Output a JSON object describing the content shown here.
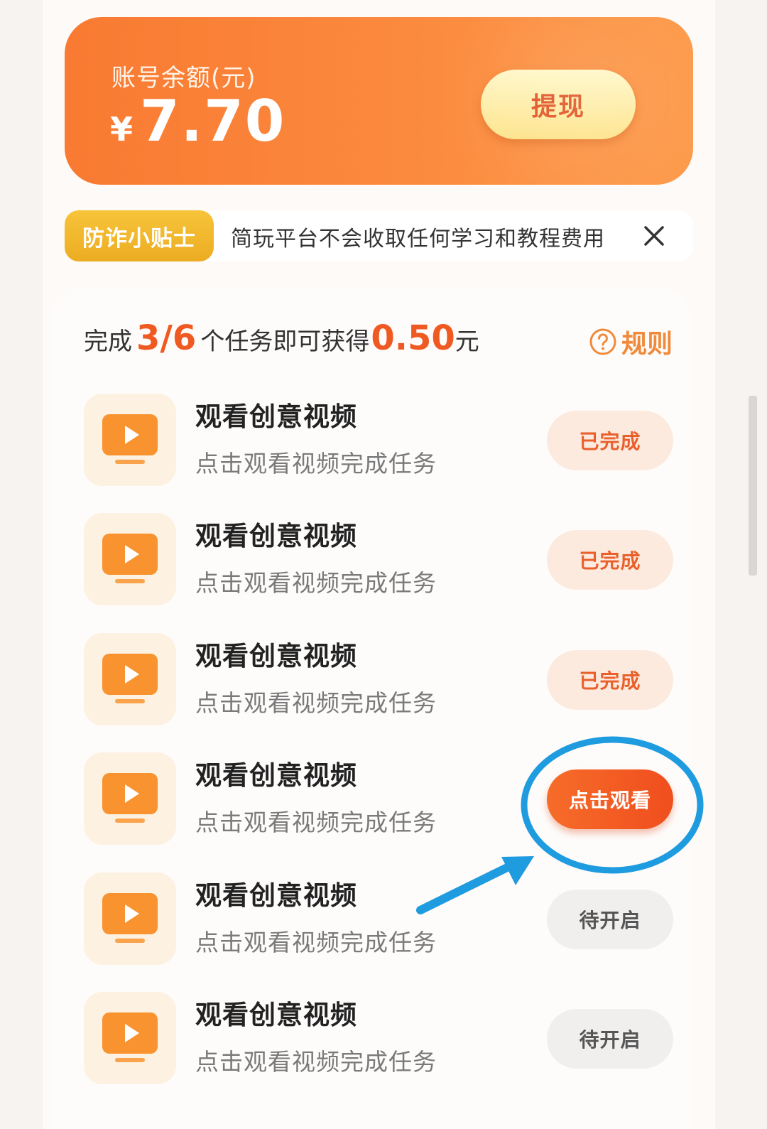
{
  "balance": {
    "label": "账号余额(元)",
    "currency": "¥",
    "amount": "7.70",
    "withdraw_label": "提现"
  },
  "tips": {
    "badge": "防诈小贴士",
    "text": "简玩平台不会收取任何学习和教程费用"
  },
  "tasks_header": {
    "prefix": "完成",
    "progress": "3/6",
    "middle": "个任务即可获得",
    "reward": "0.50",
    "suffix": "元",
    "rules_label": "规则"
  },
  "tasks": [
    {
      "title": "观看创意视频",
      "desc": "点击观看视频完成任务",
      "status": "已完成"
    },
    {
      "title": "观看创意视频",
      "desc": "点击观看视频完成任务",
      "status": "已完成"
    },
    {
      "title": "观看创意视频",
      "desc": "点击观看视频完成任务",
      "status": "已完成"
    },
    {
      "title": "观看创意视频",
      "desc": "点击观看视频完成任务",
      "status": "点击观看"
    },
    {
      "title": "观看创意视频",
      "desc": "点击观看视频完成任务",
      "status": "待开启"
    },
    {
      "title": "观看创意视频",
      "desc": "点击观看视频完成任务",
      "status": "待开启"
    }
  ],
  "colors": {
    "accent": "#f97a32",
    "highlight": "#ef5a22",
    "annotation": "#1f9be0"
  },
  "icons": {
    "task_icon": "video-play-icon",
    "close_icon": "close-icon",
    "rules_icon": "question-circle-icon"
  }
}
